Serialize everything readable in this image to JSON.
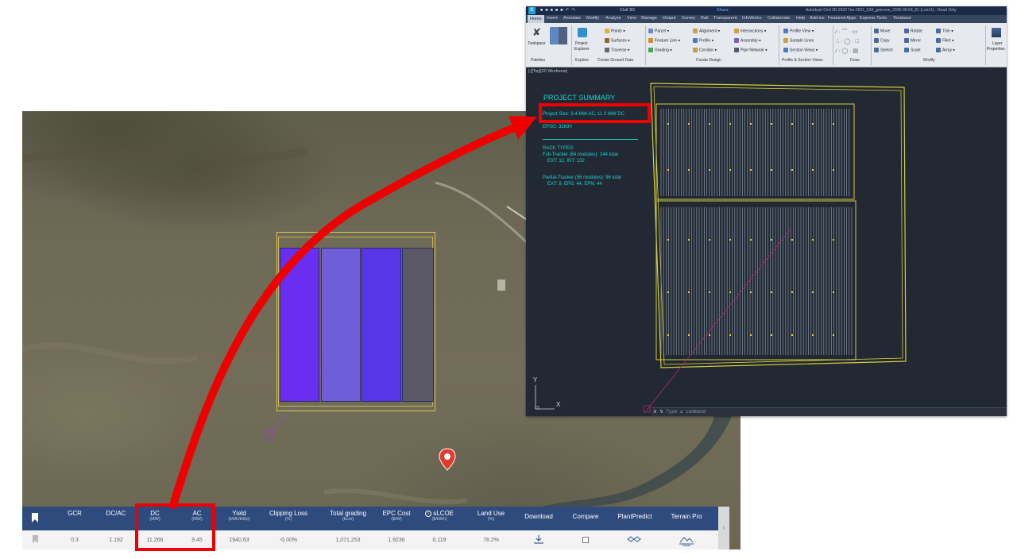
{
  "results_table": {
    "headers": [
      {
        "label": "GCR",
        "unit": ""
      },
      {
        "label": "DC/AC",
        "unit": ""
      },
      {
        "label": "DC",
        "unit": "(MW)"
      },
      {
        "label": "AC",
        "unit": "(MW)"
      },
      {
        "label": "Yield",
        "unit": "(kWh/kWp)"
      },
      {
        "label": "Clipping Loss",
        "unit": "(%)"
      },
      {
        "label": "Total grading",
        "unit": "(bcm)"
      },
      {
        "label": "EPC Cost",
        "unit": "($/W)"
      },
      {
        "label": "sLCOE",
        "unit": "($/kWh)"
      },
      {
        "label": "Land Use",
        "unit": "(%)"
      },
      {
        "label": "Download",
        "unit": ""
      },
      {
        "label": "Compare",
        "unit": ""
      },
      {
        "label": "PlantPredict",
        "unit": ""
      },
      {
        "label": "Terrain Pro",
        "unit": ""
      }
    ],
    "row": [
      "0.3",
      "1.192",
      "11.266",
      "9.45",
      "1940.63",
      "-0.00%",
      "1,071,253",
      "1.9236",
      "0.119",
      "78.2%"
    ],
    "icons": {
      "bookmark": "bookmark-icon",
      "info": "info-icon",
      "download": "download-icon",
      "compare": "checkbox-icon",
      "plantpredict": "plantpredict-icon",
      "terrain": "terrain-icon",
      "collapse": "chevron-left-icon"
    }
  },
  "civil3d": {
    "app_name": "Civil 3D",
    "share_label": "Share",
    "window_title": "Autodesk Civil 3D 2022   Ten-2621_538_grenone_2025-09-04_01 (Lcb/r1) - Read Only",
    "ribbon_tabs": [
      "Home",
      "Insert",
      "Annotate",
      "Modify",
      "Analyze",
      "View",
      "Manage",
      "Output",
      "Survey",
      "Rail",
      "Transparent",
      "InfoWorks",
      "Collaborate",
      "Help",
      "Add-ins",
      "Featured Apps",
      "Express Tools",
      "Terabase"
    ],
    "ribbon": {
      "toolspace": "Toolspace",
      "project_explorer_1": "Project",
      "project_explorer_2": "Explorer",
      "points": "Points",
      "surfaces": "Surfaces",
      "traverse": "Traverse",
      "parcel": "Parcel",
      "feature_line": "Feature Line",
      "grading": "Grading",
      "alignment": "Alignment",
      "profile": "Profile",
      "corridor": "Corridor",
      "intersections": "Intersections",
      "assembly": "Assembly",
      "pipe_network": "Pipe Network",
      "profile_view": "Profile View",
      "sample_lines": "Sample Lines",
      "section_views": "Section Views",
      "move": "Move",
      "copy": "Copy",
      "stretch": "Stretch",
      "rotate": "Rotate",
      "mirror": "Mirror",
      "scale": "Scale",
      "trim": "Trim",
      "fillet": "Fillet",
      "array": "Array",
      "layer_properties_1": "Layer",
      "layer_properties_2": "Properties"
    },
    "ribbon_groups": [
      "Palettes",
      "Explore",
      "Create Ground Data",
      "Create Design",
      "Profile & Section Views",
      "Draw",
      "Modify"
    ],
    "viewport_label": "[-][Top][2D Wireframe]",
    "summary": {
      "title": "PROJECT SUMMARY",
      "project_size": "Project Size: 9.4 MW AC, 11.3 MW DC",
      "epsg": "EPSG: 32630",
      "rack_types": "RACK TYPES:",
      "full_tracker": "Full-Tracker (84 modules): 144 total",
      "full_tracker_detail": "EXT: 12, INT: 132",
      "partial_tracker": "Partial-Tracker (56 modules): 96 total",
      "partial_tracker_detail": "EXT: 8, EPS: 44, EPN: 44"
    },
    "ucs": {
      "x": "X",
      "y": "Y"
    },
    "command_placeholder": "Type a command"
  },
  "colors": {
    "table_header": "#2f4a7d",
    "annotation_red": "#ee0000",
    "summary_cyan": "#17d6d6",
    "boundary_yellow": "#d8c94a",
    "array_blocks": [
      "#6a2ef0",
      "#6f5ed8",
      "#5636e6",
      "#5b5866"
    ]
  }
}
